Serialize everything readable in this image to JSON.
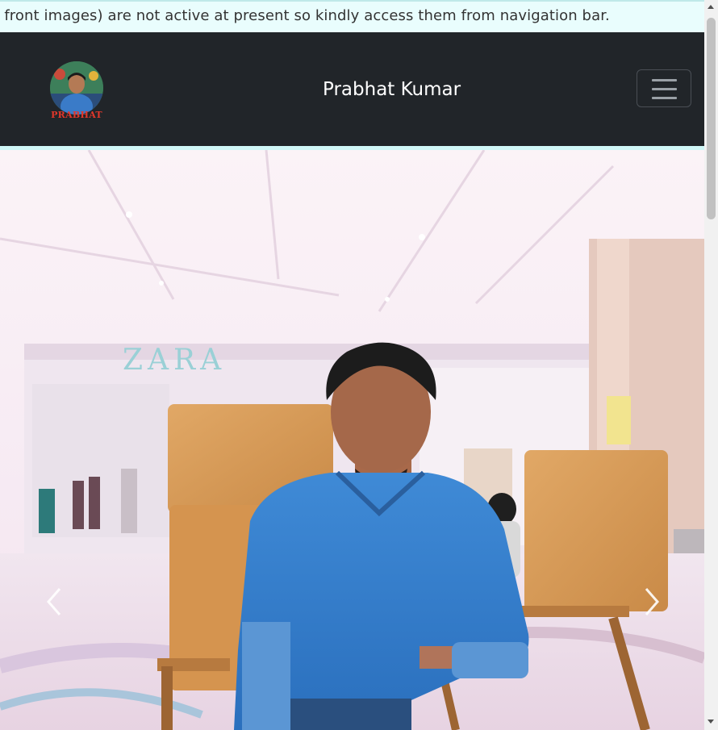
{
  "ticker": {
    "text": "n front images) are not active at present so kindly access them from navigation bar."
  },
  "navbar": {
    "brand": "Prabhat Kumar",
    "logo_caption": "PRABHAT",
    "toggler_icon": "hamburger-menu-icon"
  },
  "carousel": {
    "store_sign": "ZARA",
    "prev_icon": "chevron-left-icon",
    "next_icon": "chevron-right-icon"
  },
  "colors": {
    "navbar_bg": "#212529",
    "ticker_bg": "#e9fdfd",
    "accent_strip": "#cff7f7"
  }
}
